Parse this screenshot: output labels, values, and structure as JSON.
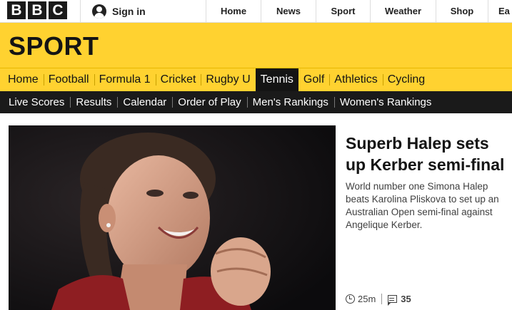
{
  "brand": {
    "logo_letters": [
      "B",
      "B",
      "C"
    ]
  },
  "account": {
    "signin_label": "Sign in",
    "icon": "user-icon"
  },
  "global_nav": [
    {
      "label": "Home"
    },
    {
      "label": "News"
    },
    {
      "label": "Sport"
    },
    {
      "label": "Weather"
    },
    {
      "label": "Shop"
    },
    {
      "label": "Ea"
    }
  ],
  "masthead": {
    "title": "SPORT",
    "color": "#ffd230"
  },
  "sport_nav": [
    {
      "label": "Home",
      "active": false
    },
    {
      "label": "Football",
      "active": false
    },
    {
      "label": "Formula 1",
      "active": false
    },
    {
      "label": "Cricket",
      "active": false
    },
    {
      "label": "Rugby U",
      "active": false
    },
    {
      "label": "Tennis",
      "active": true
    },
    {
      "label": "Golf",
      "active": false
    },
    {
      "label": "Athletics",
      "active": false
    },
    {
      "label": "Cycling",
      "active": false
    }
  ],
  "sub_nav": [
    {
      "label": "Live Scores"
    },
    {
      "label": "Results"
    },
    {
      "label": "Calendar"
    },
    {
      "label": "Order of Play"
    },
    {
      "label": "Men's Rankings"
    },
    {
      "label": "Women's Rankings"
    }
  ],
  "story": {
    "headline": "Superb Halep sets up Kerber semi-final",
    "summary": "World number one Simona Halep beats Karolina Pliskova to set up an Australian Open semi-final against Angelique Kerber.",
    "time_ago": "25m",
    "comment_count": "35",
    "icons": [
      "clock-icon",
      "comments-icon"
    ]
  }
}
